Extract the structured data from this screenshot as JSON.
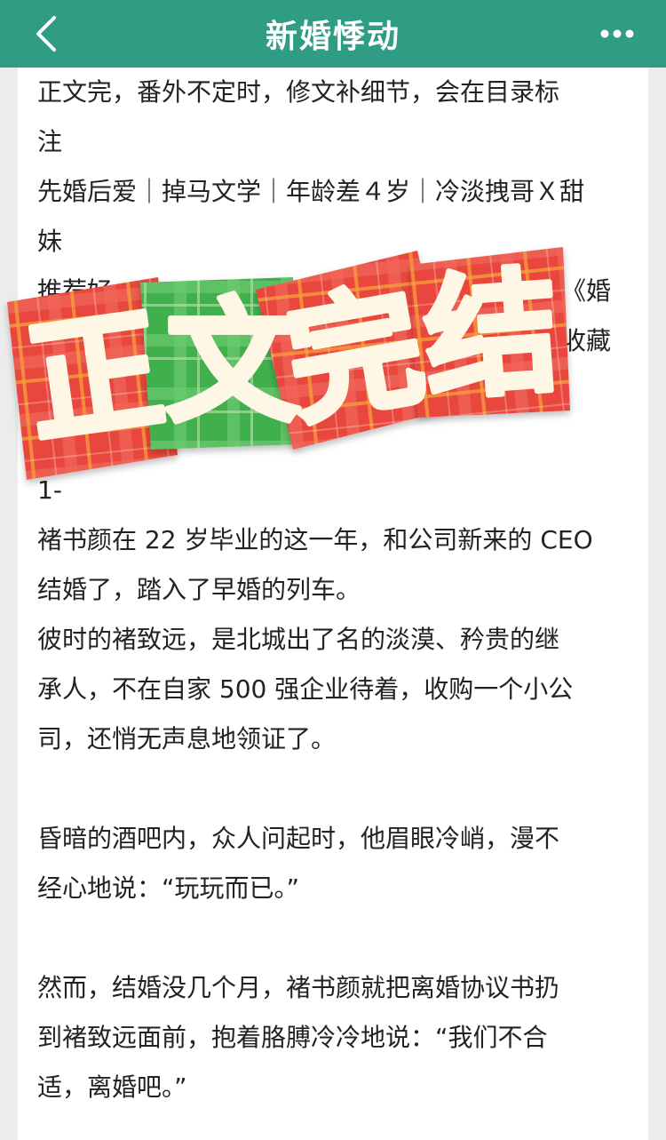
{
  "header": {
    "title": "新婚悸动",
    "back_icon": "chevron-left-icon",
    "more_icon": "more-dots-icon"
  },
  "colors": {
    "header_bg": "#2f9c84",
    "stamp_red": "#e9463c",
    "stamp_green": "#3fb04e",
    "stamp_text": "#fff7e6"
  },
  "content": {
    "lines": [
      "正文完，番外不定时，修文补细节，会在目录标",
      "注",
      "先婚后爱｜掉马文学｜年龄差４岁｜冷淡拽哥Ｘ甜",
      "妹",
      "推荐好",
      "《婚",
      "收藏",
      "1-",
      "褚书颜在 22 岁毕业的这一年，和公司新来的 CEO",
      "结婚了，踏入了早婚的列车。",
      "彼时的褚致远，是北城出了名的淡漠、矜贵的继",
      "承人，不在自家 500 强企业待着，收购一个小公",
      "司，还悄无声息地领证了。",
      "昏暗的酒吧内，众人问起时，他眉眼冷峭，漫不",
      "经心地说：“玩玩而已。”",
      "然而，结婚没几个月，褚书颜就把离婚协议书扔",
      "到褚致远面前，抱着胳膊冷冷地说：“我们不合",
      "适，离婚吧。”"
    ]
  },
  "stamp": {
    "characters": [
      "正",
      "文",
      "完",
      "结"
    ]
  }
}
